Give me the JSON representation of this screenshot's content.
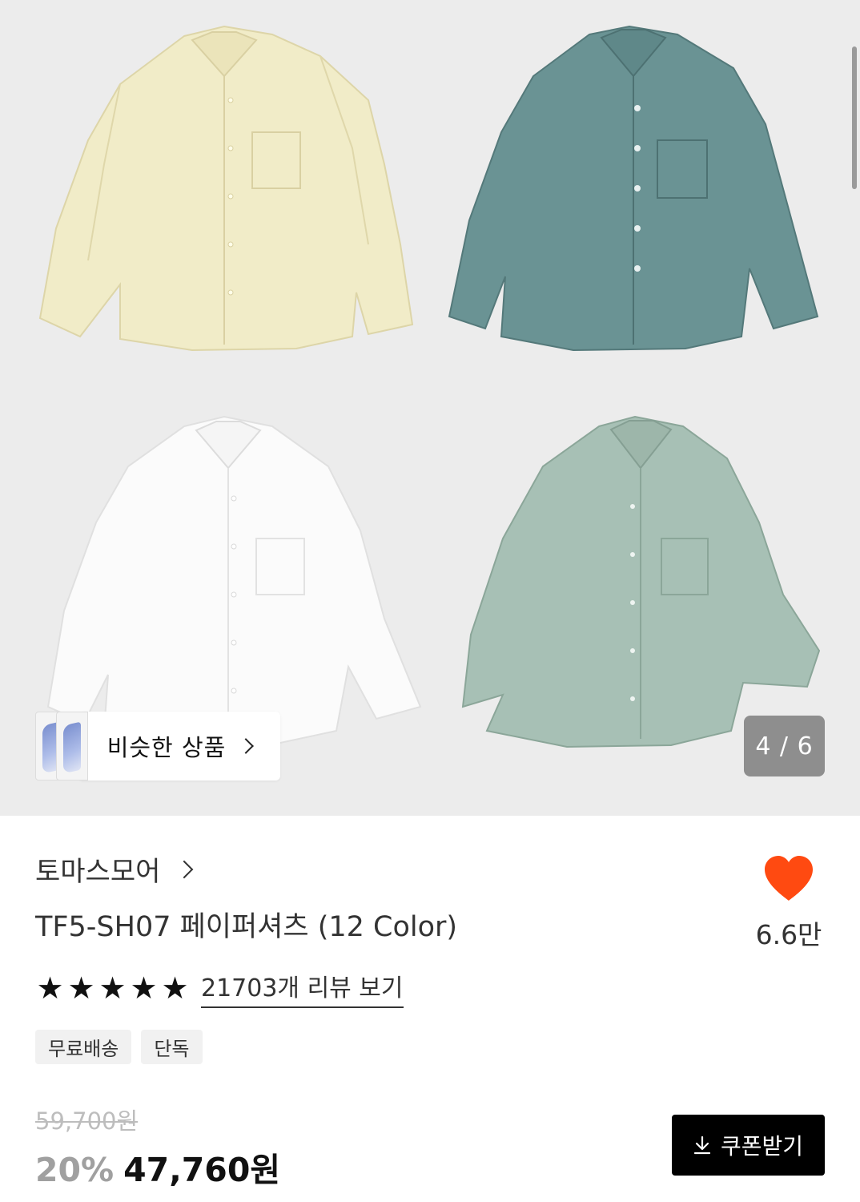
{
  "gallery": {
    "images": [
      {
        "name": "yellow shirt",
        "color": "#f1ecc8"
      },
      {
        "name": "teal shirt",
        "color": "#6a9394"
      },
      {
        "name": "white shirt",
        "color": "#fbfbfb"
      },
      {
        "name": "sage shirt",
        "color": "#a7c0b5"
      }
    ],
    "counter": "4 / 6",
    "similar_label": "비슷한 상품"
  },
  "product": {
    "brand": "토마스모어",
    "title": "TF5-SH07 페이퍼셔츠 (12 Color)",
    "rating_stars": 5,
    "review_link": "21703개 리뷰 보기",
    "likes": "6.6만",
    "tags": [
      "무료배송",
      "단독"
    ],
    "original_price": "59,700원",
    "discount": "20%",
    "price": "47,760원"
  },
  "actions": {
    "coupon_label": "쿠폰받기"
  },
  "colors": {
    "heart": "#ff4a11",
    "button_bg": "#000000",
    "counter_bg": "#8e8e8e"
  }
}
